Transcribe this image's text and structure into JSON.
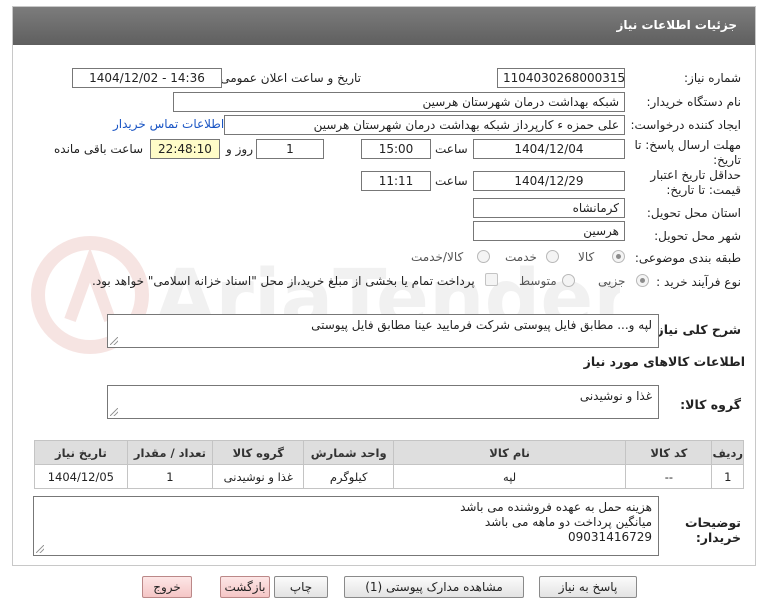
{
  "header": {
    "title": "جزئیات اطلاعات نیاز"
  },
  "fields": {
    "need_number": {
      "label": "شماره نیاز:",
      "value": "1104030268000315"
    },
    "announce": {
      "label": "تاریخ و ساعت اعلان عمومی:",
      "value": "1404/12/02 - 14:36"
    },
    "buyer_org": {
      "label": "نام دستگاه خریدار:",
      "value": "شبکه بهداشت درمان شهرستان هرسین"
    },
    "creator": {
      "label": "ایجاد کننده درخواست:",
      "value": "علی حمزه ء کارپرداز شبکه بهداشت درمان شهرستان هرسین",
      "contact_link": "اطلاعات تماس خریدار"
    },
    "deadline": {
      "label_line1": "مهلت ارسال پاسخ: تا",
      "label_line2": "تاریخ:",
      "date": "1404/12/04",
      "time_label": "ساعت",
      "time": "15:00",
      "days": "1",
      "days_label": "روز و",
      "remaining": "22:48:10",
      "remaining_label": "ساعت باقی مانده"
    },
    "validity": {
      "label_line1": "حداقل تاریخ اعتبار",
      "label_line2": "قیمت: تا تاریخ:",
      "date": "1404/12/29",
      "time_label": "ساعت",
      "time": "11:11"
    },
    "province": {
      "label": "استان محل تحویل:",
      "value": "کرمانشاه"
    },
    "city": {
      "label": "شهر محل تحویل:",
      "value": "هرسین"
    },
    "category": {
      "label": "طبقه بندی موضوعی:",
      "options": [
        "کالا",
        "خدمت",
        "کالا/خدمت"
      ],
      "selected": "کالا"
    },
    "process": {
      "label": "نوع فرآیند خرید :",
      "options": [
        "جزیی",
        "متوسط"
      ],
      "selected": "جزیی",
      "payment_note": "پرداخت تمام یا بخشی از مبلغ خرید،از محل \"اسناد خزانه اسلامی\" خواهد بود."
    }
  },
  "summary": {
    "label": "شرح کلی نیاز:",
    "value": "لپه و... مطابق فایل پیوستی شرکت فرمایید عینا مطابق فایل پیوستی"
  },
  "goods_section": {
    "title": "اطلاعات کالاهای مورد نیاز",
    "group_label": "گروه کالا:",
    "group_value": "غذا و نوشیدنی"
  },
  "table": {
    "headers": [
      "ردیف",
      "کد کالا",
      "نام کالا",
      "واحد شمارش",
      "گروه کالا",
      "تعداد / مقدار",
      "تاریخ نیاز"
    ],
    "rows": [
      [
        "1",
        "--",
        "لپه",
        "کیلوگرم",
        "غذا و نوشیدنی",
        "1",
        "1404/12/05"
      ]
    ]
  },
  "buyer_notes": {
    "label_line1": "توضیحات",
    "label_line2": "خریدار:",
    "lines": [
      "هزینه حمل به عهده فروشنده می باشد",
      "میانگین پرداخت دو ماهه می باشد",
      "09031416729"
    ]
  },
  "buttons": {
    "reply": "پاسخ به نیاز",
    "attachments": "مشاهده مدارک پیوستی (1)",
    "print": "چاپ",
    "back": "بازگشت",
    "exit": "خروج"
  },
  "watermark_text": "AriaTender.net"
}
